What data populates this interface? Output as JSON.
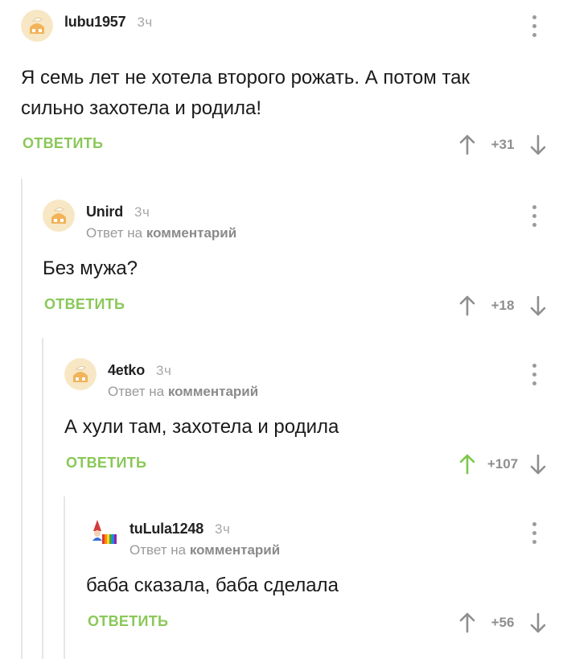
{
  "comments": [
    {
      "username": "lubu1957",
      "time": "3ч",
      "reply_to": "",
      "text": "Я семь лет не хотела второго рожать. А потом так сильно захотела и родила!",
      "reply_label": "ОТВЕТИТЬ",
      "score": "+31",
      "upvoted": false,
      "avatar": "default-avatar-icon"
    },
    {
      "username": "Unird",
      "time": "3ч",
      "reply_to": {
        "prefix": "Ответ на",
        "link": "комментарий"
      },
      "text": "Без мужа?",
      "reply_label": "ОТВЕТИТЬ",
      "score": "+18",
      "upvoted": false,
      "avatar": "default-avatar-icon"
    },
    {
      "username": "4etko",
      "time": "3ч",
      "reply_to": {
        "prefix": "Ответ на",
        "link": "комментарий"
      },
      "text": "А хули там, захотела и родила",
      "reply_label": "ОТВЕТИТЬ",
      "score": "+107",
      "upvoted": true,
      "avatar": "default-avatar-icon"
    },
    {
      "username": "tuLula1248",
      "time": "3ч",
      "reply_to": {
        "prefix": "Ответ на",
        "link": "комментарий"
      },
      "text": "баба сказала, баба сделала",
      "reply_label": "ОТВЕТИТЬ",
      "score": "+56",
      "upvoted": false,
      "avatar": "gnome-rainbow-avatar-icon"
    }
  ],
  "colors": {
    "accent_green": "#8ac858",
    "upvote_active": "#7ec74a",
    "arrow_default": "#8f8f8f",
    "thread_line": "#e6e6e6"
  }
}
